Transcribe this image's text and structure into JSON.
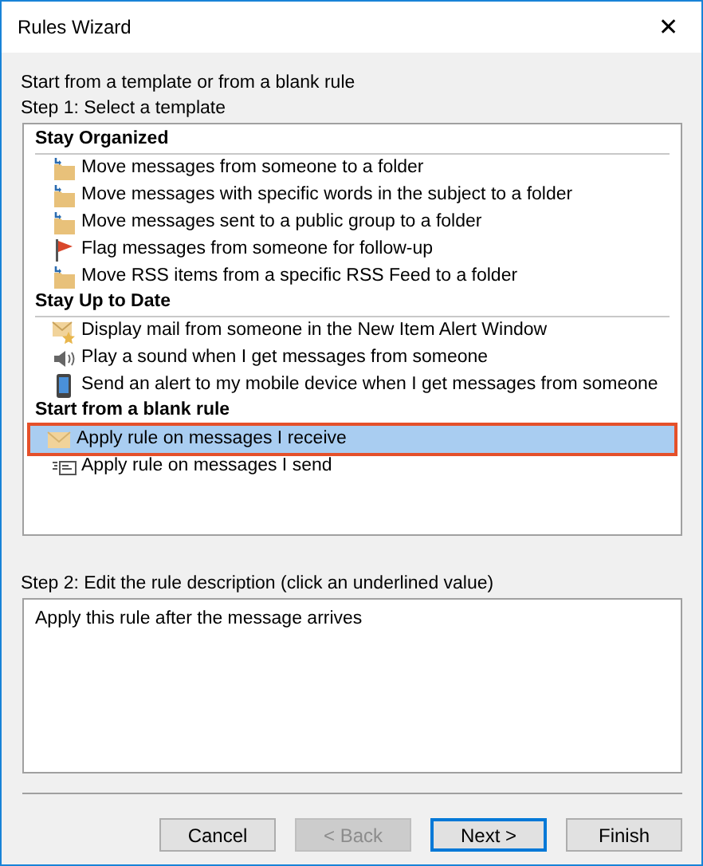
{
  "window": {
    "title": "Rules Wizard",
    "close": "✕"
  },
  "intro": "Start from a template or from a blank rule",
  "step1": "Step 1: Select a template",
  "groups": [
    {
      "title": "Stay Organized",
      "items": [
        {
          "kind": "move",
          "label": "Move messages from someone to a folder",
          "selected": false
        },
        {
          "kind": "move",
          "label": "Move messages with specific words in the subject to a folder",
          "selected": false
        },
        {
          "kind": "move",
          "label": "Move messages sent to a public group to a folder",
          "selected": false
        },
        {
          "kind": "flag",
          "label": "Flag messages from someone for follow-up",
          "selected": false
        },
        {
          "kind": "move",
          "label": "Move RSS items from a specific RSS Feed to a folder",
          "selected": false
        }
      ]
    },
    {
      "title": "Stay Up to Date",
      "items": [
        {
          "kind": "alert",
          "label": "Display mail from someone in the New Item Alert Window",
          "selected": false
        },
        {
          "kind": "sound",
          "label": "Play a sound when I get messages from someone",
          "selected": false
        },
        {
          "kind": "mobile",
          "label": "Send an alert to my mobile device when I get messages from someone",
          "selected": false
        }
      ]
    },
    {
      "title": "Start from a blank rule",
      "items": [
        {
          "kind": "receive",
          "label": "Apply rule on messages I receive",
          "selected": true
        },
        {
          "kind": "send",
          "label": "Apply rule on messages I send",
          "selected": false
        }
      ]
    }
  ],
  "step2": "Step 2: Edit the rule description (click an underlined value)",
  "description": "Apply this rule after the message arrives",
  "buttons": [
    {
      "label": "Cancel",
      "disabled": false,
      "default": false
    },
    {
      "label": "< Back",
      "disabled": true,
      "default": false
    },
    {
      "label": "Next >",
      "disabled": false,
      "default": true
    },
    {
      "label": "Finish",
      "disabled": false,
      "default": false
    }
  ]
}
